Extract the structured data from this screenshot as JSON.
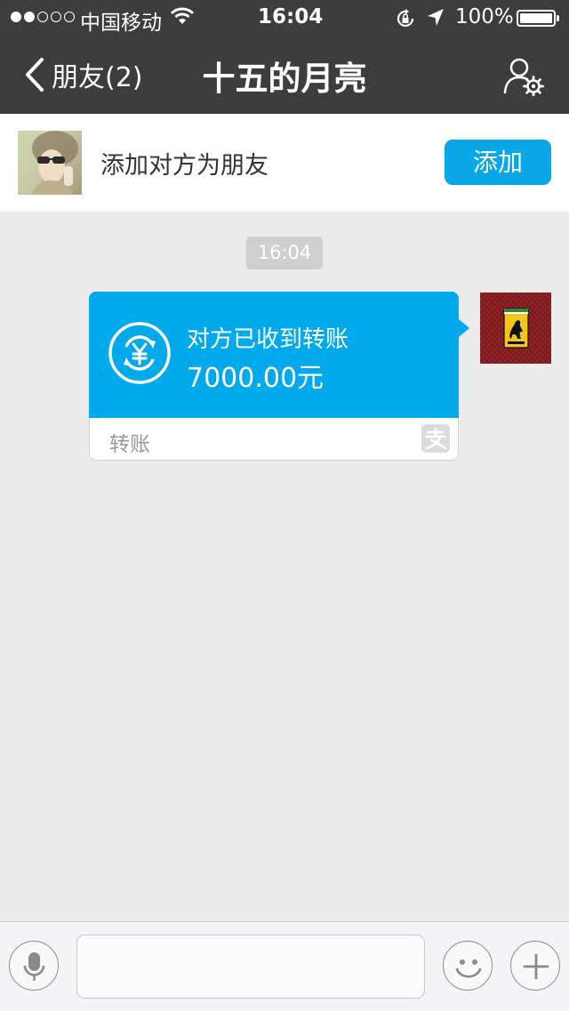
{
  "status_bar": {
    "carrier": "中国移动",
    "time": "16:04",
    "battery": "100%",
    "signal_bars_filled": 2,
    "signal_bars_total": 5
  },
  "nav": {
    "back_label": "朋友(2)",
    "title": "十五的月亮",
    "right_icon": "contact-settings-icon"
  },
  "add_friend": {
    "prompt": "添加对方为朋友",
    "button_label": "添加"
  },
  "chat": {
    "timestamp": "16:04",
    "transfer": {
      "status": "对方已收到转账",
      "amount": "7000.00元",
      "type_label": "转账",
      "brand_icon": "alipay-icon"
    }
  },
  "input_bar": {
    "message_value": "",
    "left_icon": "microphone-icon",
    "right_icons": [
      "emoji-icon",
      "plus-icon"
    ]
  },
  "colors": {
    "nav_bg": "#3d3d3d",
    "accent": "#0aa7e8",
    "card_blue": "#00a8ec",
    "chat_bg": "#ebebeb"
  }
}
